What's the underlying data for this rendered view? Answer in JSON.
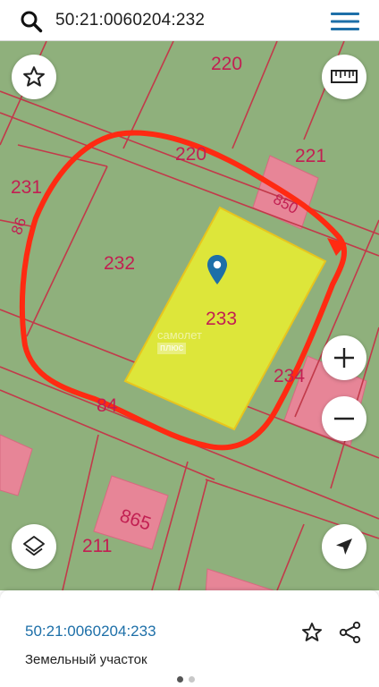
{
  "search": {
    "query": "50:21:0060204:232"
  },
  "map": {
    "parcels": [
      {
        "id": "220",
        "label": "220"
      },
      {
        "id": "221",
        "label": "221"
      },
      {
        "id": "231",
        "label": "231"
      },
      {
        "id": "232",
        "label": "232"
      },
      {
        "id": "233",
        "label": "233"
      },
      {
        "id": "234",
        "label": "234"
      },
      {
        "id": "211",
        "label": "211"
      },
      {
        "id": "865",
        "label": "865"
      },
      {
        "id": "850",
        "label": "850"
      },
      {
        "id": "220b",
        "label": "220"
      },
      {
        "id": "86x",
        "label": "86"
      },
      {
        "id": "84x",
        "label": "84"
      }
    ],
    "watermark": {
      "line1": "самолет",
      "line2": "плюс"
    },
    "colors": {
      "land": "#8fb07c",
      "boundary": "#c23a4a",
      "building": "#e78597",
      "selected_parcel": "#dde63a",
      "hand_drawn": "#ff2a12",
      "pin": "#1d6fa8"
    }
  },
  "controls": {
    "favorite": "star-icon",
    "ruler": "ruler-icon",
    "zoom_in": "plus-icon",
    "zoom_out": "minus-icon",
    "layers": "layers-icon",
    "locate": "navigation-arrow-icon"
  },
  "sheet": {
    "cadastral_number": "50:21:0060204:233",
    "object_type": "Земельный участок",
    "pager": {
      "count": 2,
      "active": 0
    }
  }
}
